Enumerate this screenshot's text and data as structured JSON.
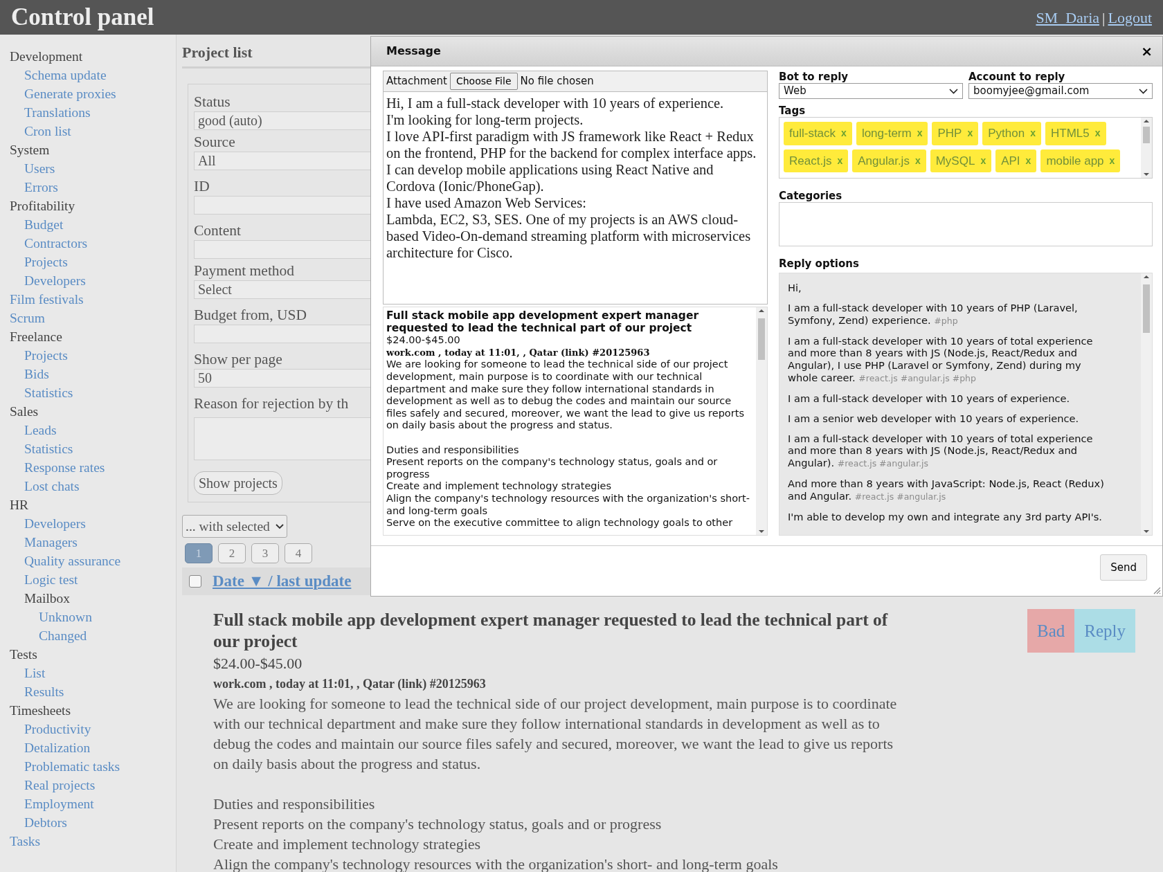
{
  "header": {
    "title": "Control panel",
    "user": "SM_Daria",
    "separator": "|",
    "logout": "Logout"
  },
  "sidebar": {
    "items": [
      {
        "label": "Development",
        "kind": "group",
        "children": [
          {
            "label": "Schema update",
            "kind": "link"
          },
          {
            "label": "Generate proxies",
            "kind": "link"
          },
          {
            "label": "Translations",
            "kind": "link"
          },
          {
            "label": "Cron list",
            "kind": "link"
          }
        ]
      },
      {
        "label": "System",
        "kind": "group",
        "children": [
          {
            "label": "Users",
            "kind": "link"
          },
          {
            "label": "Errors",
            "kind": "link"
          }
        ]
      },
      {
        "label": "Profitability",
        "kind": "group",
        "children": [
          {
            "label": "Budget",
            "kind": "link"
          },
          {
            "label": "Contractors",
            "kind": "link"
          },
          {
            "label": "Projects",
            "kind": "link"
          },
          {
            "label": "Developers",
            "kind": "link"
          }
        ]
      },
      {
        "label": "Film festivals",
        "kind": "link"
      },
      {
        "label": "Scrum",
        "kind": "link"
      },
      {
        "label": "Freelance",
        "kind": "group",
        "children": [
          {
            "label": "Projects",
            "kind": "link"
          },
          {
            "label": "Bids",
            "kind": "link"
          },
          {
            "label": "Statistics",
            "kind": "link"
          }
        ]
      },
      {
        "label": "Sales",
        "kind": "group",
        "children": [
          {
            "label": "Leads",
            "kind": "link"
          },
          {
            "label": "Statistics",
            "kind": "link"
          },
          {
            "label": "Response rates",
            "kind": "link"
          },
          {
            "label": "Lost chats",
            "kind": "link"
          }
        ]
      },
      {
        "label": "HR",
        "kind": "group",
        "children": [
          {
            "label": "Developers",
            "kind": "link"
          },
          {
            "label": "Managers",
            "kind": "link"
          },
          {
            "label": "Quality assurance",
            "kind": "link"
          },
          {
            "label": "Logic test",
            "kind": "link"
          },
          {
            "label": "Mailbox",
            "kind": "group",
            "children": [
              {
                "label": "Unknown",
                "kind": "link"
              },
              {
                "label": "Changed",
                "kind": "link"
              }
            ]
          }
        ]
      },
      {
        "label": "Tests",
        "kind": "group",
        "children": [
          {
            "label": "List",
            "kind": "link"
          },
          {
            "label": "Results",
            "kind": "link"
          }
        ]
      },
      {
        "label": "Timesheets",
        "kind": "group",
        "children": [
          {
            "label": "Productivity",
            "kind": "link"
          },
          {
            "label": "Detalization",
            "kind": "link"
          },
          {
            "label": "Problematic tasks",
            "kind": "link"
          },
          {
            "label": "Real projects",
            "kind": "link"
          },
          {
            "label": "Employment",
            "kind": "link"
          },
          {
            "label": "Debtors",
            "kind": "link"
          }
        ]
      },
      {
        "label": "Tasks",
        "kind": "link"
      }
    ]
  },
  "main": {
    "title": "Project list",
    "filters": [
      {
        "label": "Status",
        "kind": "select",
        "value": "good (auto)"
      },
      {
        "label": "Source",
        "kind": "select",
        "value": "All"
      },
      {
        "label": "ID",
        "kind": "input"
      },
      {
        "label": "Content",
        "kind": "input"
      },
      {
        "label": "Payment method",
        "kind": "select",
        "value": "Select"
      },
      {
        "label": "Budget from, USD",
        "kind": "input"
      },
      {
        "label": "Show per page",
        "kind": "input",
        "value": "50"
      },
      {
        "label": "Reason for rejection by th",
        "kind": "textarea"
      }
    ],
    "show_button": "Show projects",
    "bulk_action": "... with selected",
    "pages": [
      {
        "label": "1",
        "selected": true
      },
      {
        "label": "2",
        "selected": false
      },
      {
        "label": "3",
        "selected": false
      },
      {
        "label": "4",
        "selected": false
      }
    ],
    "sort_header": {
      "checked": false,
      "label": "Date ▼ / last update"
    },
    "project": {
      "title": "Full stack mobile app development expert manager requested to lead the technical part of our project",
      "price": "$24.00-$45.00",
      "meta": {
        "source": "work.com , today at 11:01, , Qatar",
        "link": "(link)",
        "id": "#20125963"
      },
      "description": "We are looking for someone to lead the technical side of our project development, main purpose is to coordinate with our technical department and make sure they follow international standards in development as well as to debug the codes and maintain our source files safely and secured, moreover, we want the lead to give us reports on daily basis about the progress and status.",
      "duties": [
        "Duties and responsibilities",
        "Present reports on the company's technology status, goals and or progress",
        "Create and implement technology strategies",
        "Align the company's technology resources with the organization's short- and long-term goals"
      ]
    },
    "actions": [
      {
        "label": "Bad",
        "kind": "bad"
      },
      {
        "label": "Reply",
        "kind": "reply"
      }
    ]
  },
  "modal": {
    "title": "Message",
    "close": "×",
    "attachment": {
      "label": "Attachment",
      "button": "Choose File",
      "status": "No file chosen"
    },
    "message": [
      "Hi, I am a full-stack developer with 10 years of experience.",
      "I'm looking for long-term projects.",
      "I love API-first paradigm with JS framework like React + Redux on the frontend, PHP for the backend for complex interface apps.",
      "I can develop mobile applications using React Native and Cordova (Ionic/PhoneGap).",
      "I have used Amazon Web Services:",
      "Lambda, EC2, S3, SES. One of my projects is an AWS cloud-based Video-On-demand streaming platform with microservices architecture for Cisco."
    ],
    "job": {
      "title": "Full stack mobile app development expert manager requested to lead the technical part of our project",
      "price": "$24.00-$45.00",
      "meta": {
        "source": "work.com , today at 11:01, , Qatar",
        "link": "(link)",
        "id": "#20125963"
      },
      "description": "We are looking for someone to lead the technical side of our project development, main purpose is to coordinate with our technical department and make sure they follow international standards in development as well as to debug the codes and maintain our source files safely and secured, moreover, we want the lead to give us reports on daily basis about the progress and status.",
      "duties": [
        "Duties and responsibilities",
        "Present reports on the company's technology status, goals and or progress",
        "Create and implement technology strategies",
        "Align the company's technology resources with the organization's short- and long-term goals",
        "Serve on the executive committee to align technology goals to other"
      ]
    },
    "bot": {
      "label": "Bot to reply",
      "value": "Web"
    },
    "account": {
      "label": "Account to reply",
      "value": "boomyjee@gmail.com"
    },
    "tags": {
      "label": "Tags",
      "items": [
        {
          "label": "full-stack",
          "remove": "x"
        },
        {
          "label": "long-term",
          "remove": "x"
        },
        {
          "label": "PHP",
          "remove": "x"
        },
        {
          "label": "Python",
          "remove": "x"
        },
        {
          "label": "HTML5",
          "remove": "x"
        },
        {
          "label": "React.js",
          "remove": "x"
        },
        {
          "label": "Angular.js",
          "remove": "x"
        },
        {
          "label": "MySQL",
          "remove": "x"
        },
        {
          "label": "API",
          "remove": "x"
        },
        {
          "label": "mobile app",
          "remove": "x"
        }
      ]
    },
    "categories": {
      "label": "Categories"
    },
    "reply_options": {
      "label": "Reply options",
      "items": [
        {
          "text": "Hi,"
        },
        {
          "text": "I am a full-stack developer with 10 years of PHP (Laravel, Symfony, Zend) experience.",
          "tags": "#php"
        },
        {
          "text": "I am a full-stack developer with 10 years of total experience and more than 8 years with JS (Node.js, React/Redux and Angular), I use PHP (Laravel or Symfony, Zend) during my whole career.",
          "tags": "#react.js #angular.js #php"
        },
        {
          "text": "I am a full-stack developer with 10 years of experience."
        },
        {
          "text": "I am a senior web developer with 10 years of experience."
        },
        {
          "text": "I am a full-stack developer with 10 years of total experience and more than 8 years with JS (Node.js, React/Redux and Angular).",
          "tags": "#react.js #angular.js"
        },
        {
          "text": "And more than 8 years with JavaScript: Node.js, React (Redux) and Angular.",
          "tags": "#react.js #angular.js"
        },
        {
          "text": "I'm able to develop my own and integrate any 3rd party API's."
        }
      ]
    },
    "send": "Send"
  }
}
